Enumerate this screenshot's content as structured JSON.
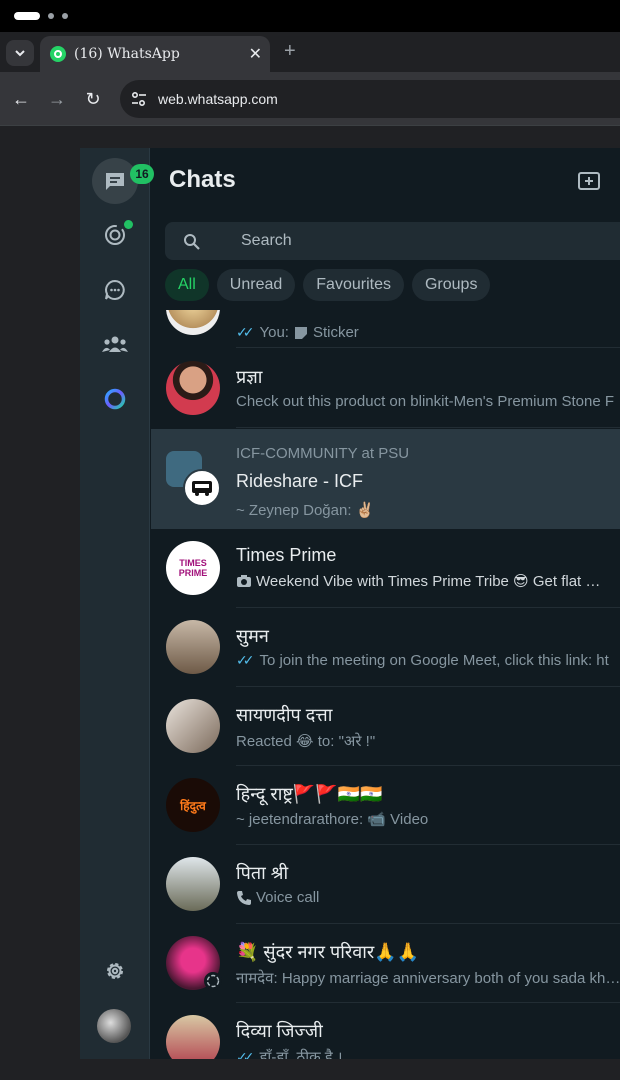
{
  "browser": {
    "tab_title": "(16)  WhatsApp",
    "tab_close": "✕",
    "new_tab": "+",
    "url": "web.whatsapp.com",
    "tab_menu_icon": "chevron-down-icon",
    "back": "←",
    "forward": "→",
    "reload": "↻"
  },
  "rail": {
    "chats_badge": "16",
    "items": [
      "chats-icon",
      "status-icon",
      "channels-icon",
      "communities-icon",
      "meta-ai-icon",
      "settings-icon"
    ]
  },
  "header": {
    "title": "Chats"
  },
  "search": {
    "placeholder": "Search"
  },
  "filters": [
    "All",
    "Unread",
    "Favourites",
    "Groups"
  ],
  "chats": [
    {
      "name": "",
      "preview_prefix": "You: ",
      "preview": "Sticker",
      "ticks": true
    },
    {
      "name": "प्रज्ञा",
      "preview": "Check out this product on blinkit-Men's Premium Stone F"
    },
    {
      "community": "ICF-COMMUNITY at PSU",
      "name": "Rideshare - ICF",
      "preview": "~ Zeynep Doğan: ✌🏼",
      "selected": true
    },
    {
      "name": "Times Prime",
      "preview": "Weekend Vibe with Times Prime Tribe 😎 Get flat …",
      "avatar_text": "TIMES PRIME"
    },
    {
      "name": "सुमन",
      "preview": "To join the meeting on Google Meet, click this link:  ht",
      "ticks": true
    },
    {
      "name": "सायणदीप दत्ता",
      "preview": "Reacted 😂 to: \"अरे !\""
    },
    {
      "name": "हिन्दू राष्ट्र🚩🚩🇮🇳🇮🇳",
      "preview": "~ jeetendrarathore: 📹 Video",
      "avatar_text": "हिंदुत्व"
    },
    {
      "name": "पिता श्री",
      "preview": "Voice call"
    },
    {
      "name": "💐 सुंदर नगर परिवार🙏🙏",
      "preview": "नामदेव: Happy marriage anniversary both of you sada kh…"
    },
    {
      "name": "दिव्या जिज्जी",
      "preview": "हाँ-हाँ, ठीक है ।",
      "ticks": true
    }
  ],
  "colors": {
    "accent": "#25d366",
    "panel": "#111b21",
    "rail": "#202c33",
    "selected": "#2a3942"
  }
}
